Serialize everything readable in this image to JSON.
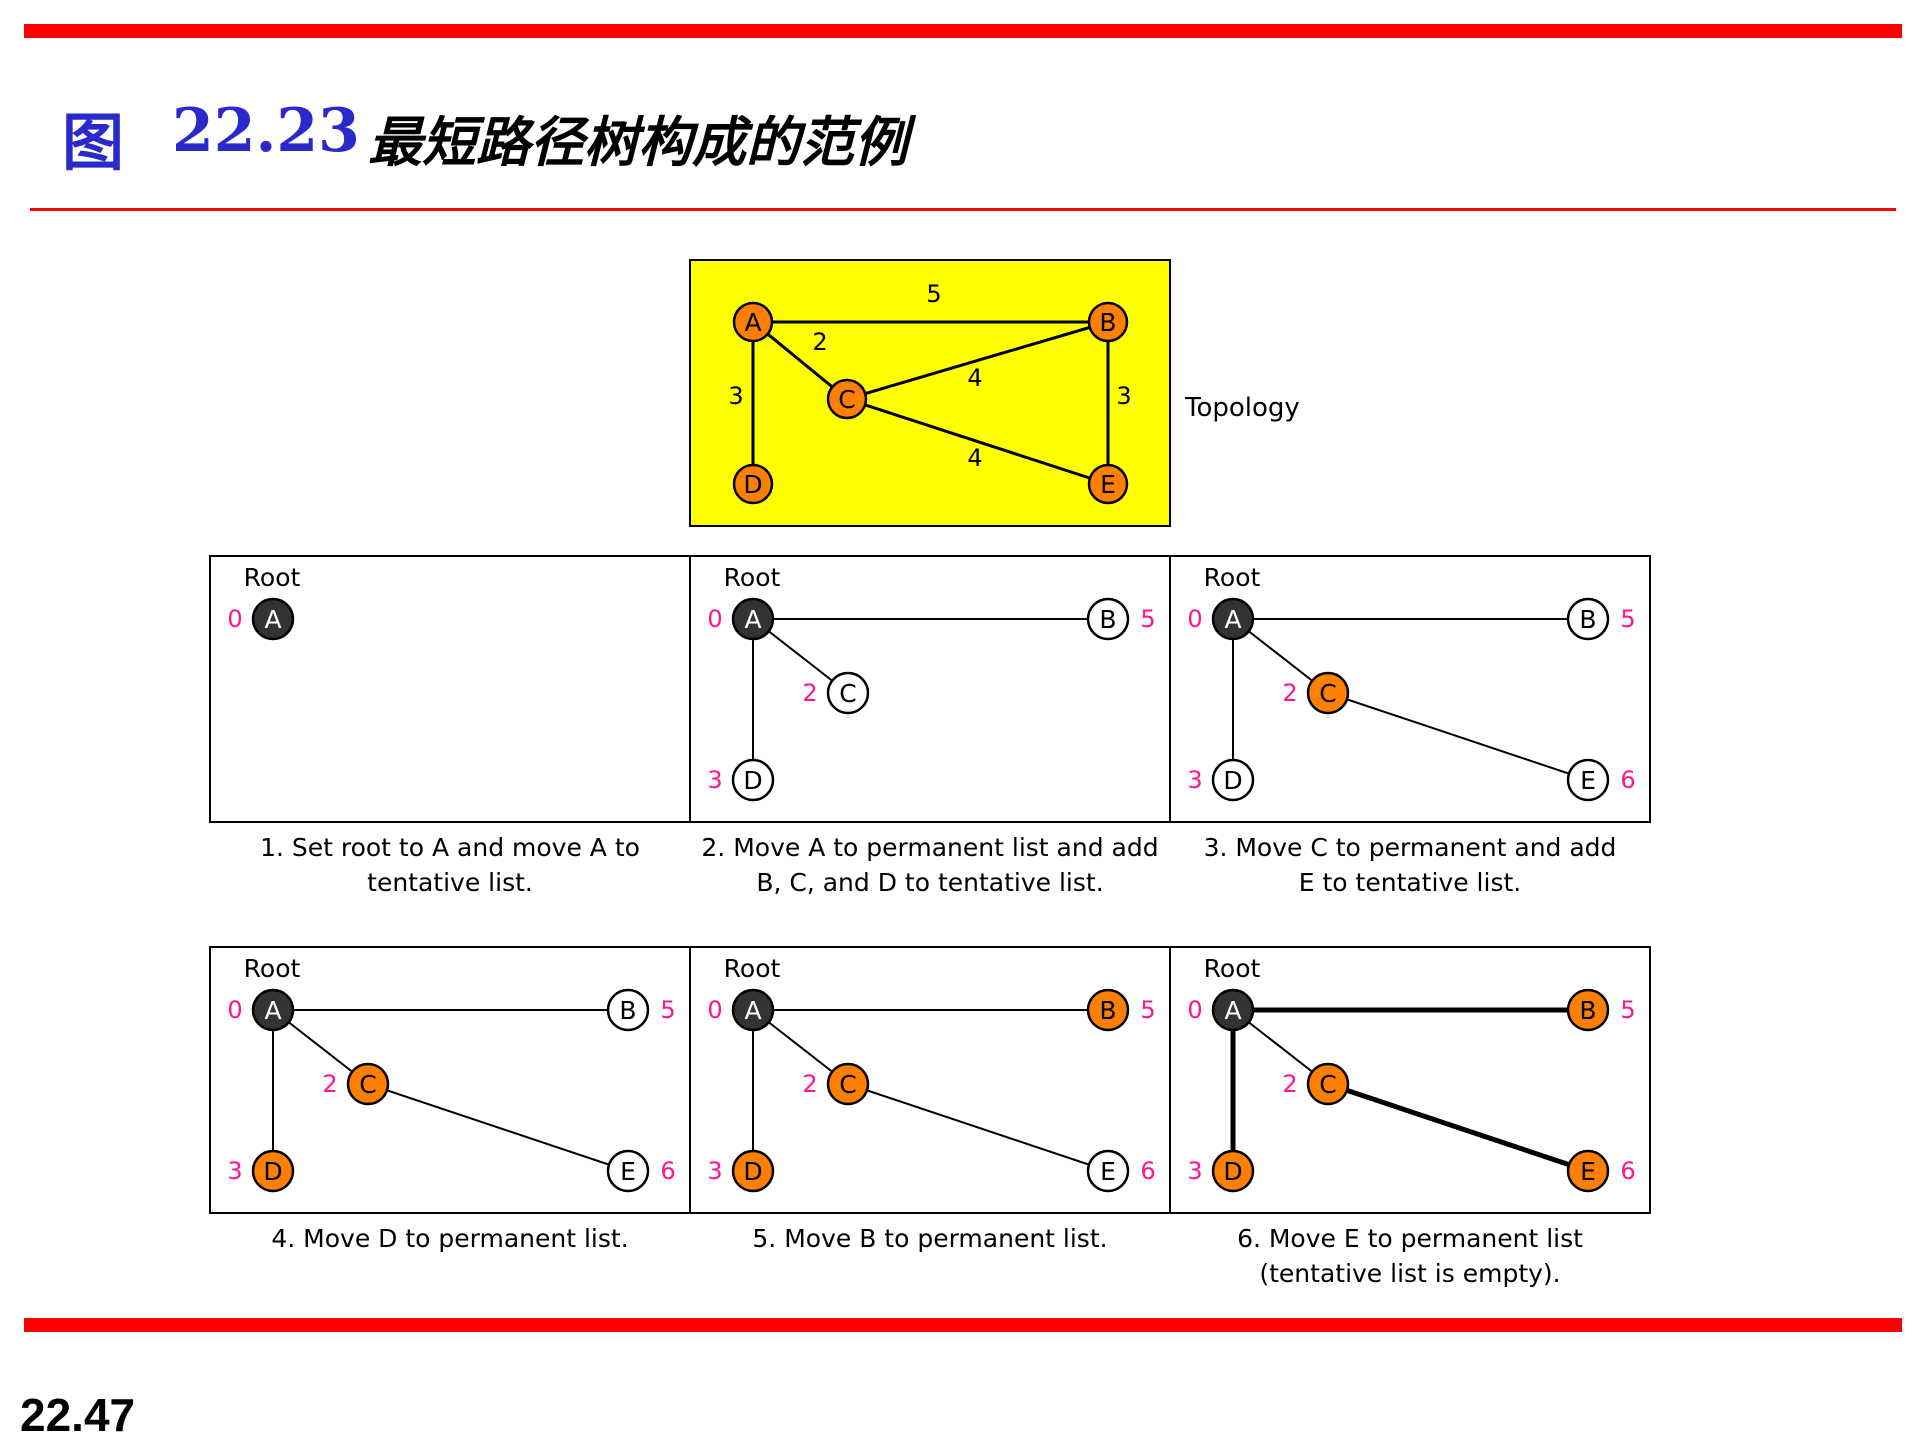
{
  "header": {
    "figure_label": "图",
    "figure_number": "22.23",
    "title": "最短路径树构成的范例"
  },
  "footer": {
    "page_number": "22.47"
  },
  "topology": {
    "label": "Topology",
    "background": "#ffff00",
    "nodes": [
      "A",
      "B",
      "C",
      "D",
      "E"
    ],
    "edges": [
      {
        "from": "A",
        "to": "B",
        "cost": "5"
      },
      {
        "from": "A",
        "to": "C",
        "cost": "2"
      },
      {
        "from": "A",
        "to": "D",
        "cost": "3"
      },
      {
        "from": "C",
        "to": "B",
        "cost": "4"
      },
      {
        "from": "C",
        "to": "E",
        "cost": "4"
      },
      {
        "from": "B",
        "to": "E",
        "cost": "3"
      }
    ]
  },
  "steps": [
    {
      "root_label": "Root",
      "caption": [
        "1. Set root to A and move A to",
        "tentative list."
      ],
      "nodes": [
        {
          "id": "A",
          "state": "root",
          "cost": "0"
        }
      ],
      "edges": []
    },
    {
      "root_label": "Root",
      "caption": [
        "2. Move A to permanent list and add",
        "B, C, and D to tentative list."
      ],
      "nodes": [
        {
          "id": "A",
          "state": "root",
          "cost": "0"
        },
        {
          "id": "B",
          "state": "tentative",
          "cost": "5"
        },
        {
          "id": "C",
          "state": "tentative",
          "cost": "2"
        },
        {
          "id": "D",
          "state": "tentative",
          "cost": "3"
        }
      ],
      "edges": [
        {
          "from": "A",
          "to": "B"
        },
        {
          "from": "A",
          "to": "C"
        },
        {
          "from": "A",
          "to": "D"
        }
      ]
    },
    {
      "root_label": "Root",
      "caption": [
        "3. Move C to permanent and add",
        "E to tentative list."
      ],
      "nodes": [
        {
          "id": "A",
          "state": "root",
          "cost": "0"
        },
        {
          "id": "B",
          "state": "tentative",
          "cost": "5"
        },
        {
          "id": "C",
          "state": "permanent",
          "cost": "2"
        },
        {
          "id": "D",
          "state": "tentative",
          "cost": "3"
        },
        {
          "id": "E",
          "state": "tentative",
          "cost": "6"
        }
      ],
      "edges": [
        {
          "from": "A",
          "to": "B"
        },
        {
          "from": "A",
          "to": "C"
        },
        {
          "from": "A",
          "to": "D"
        },
        {
          "from": "C",
          "to": "E"
        }
      ]
    },
    {
      "root_label": "Root",
      "caption": [
        "4. Move D to permanent list."
      ],
      "nodes": [
        {
          "id": "A",
          "state": "root",
          "cost": "0"
        },
        {
          "id": "B",
          "state": "tentative",
          "cost": "5"
        },
        {
          "id": "C",
          "state": "permanent",
          "cost": "2"
        },
        {
          "id": "D",
          "state": "permanent",
          "cost": "3"
        },
        {
          "id": "E",
          "state": "tentative",
          "cost": "6"
        }
      ],
      "edges": [
        {
          "from": "A",
          "to": "B"
        },
        {
          "from": "A",
          "to": "C"
        },
        {
          "from": "A",
          "to": "D"
        },
        {
          "from": "C",
          "to": "E"
        }
      ]
    },
    {
      "root_label": "Root",
      "caption": [
        "5. Move B to permanent list."
      ],
      "nodes": [
        {
          "id": "A",
          "state": "root",
          "cost": "0"
        },
        {
          "id": "B",
          "state": "permanent",
          "cost": "5"
        },
        {
          "id": "C",
          "state": "permanent",
          "cost": "2"
        },
        {
          "id": "D",
          "state": "permanent",
          "cost": "3"
        },
        {
          "id": "E",
          "state": "tentative",
          "cost": "6"
        }
      ],
      "edges": [
        {
          "from": "A",
          "to": "B"
        },
        {
          "from": "A",
          "to": "C"
        },
        {
          "from": "A",
          "to": "D"
        },
        {
          "from": "C",
          "to": "E"
        }
      ]
    },
    {
      "root_label": "Root",
      "caption": [
        "6. Move E to permanent list",
        "(tentative list is empty)."
      ],
      "nodes": [
        {
          "id": "A",
          "state": "root",
          "cost": "0"
        },
        {
          "id": "B",
          "state": "permanent",
          "cost": "5"
        },
        {
          "id": "C",
          "state": "permanent",
          "cost": "2"
        },
        {
          "id": "D",
          "state": "permanent",
          "cost": "3"
        },
        {
          "id": "E",
          "state": "permanent",
          "cost": "6"
        }
      ],
      "edges": [
        {
          "from": "A",
          "to": "B",
          "bold": true
        },
        {
          "from": "A",
          "to": "C"
        },
        {
          "from": "A",
          "to": "D",
          "bold": true
        },
        {
          "from": "C",
          "to": "E",
          "bold": true
        }
      ]
    }
  ],
  "colors": {
    "bar": "#ff0000",
    "node_fill": "#ff8000",
    "root_fill": "#333333",
    "cost_text": "#ff1493",
    "title_blue": "#2a2acb"
  }
}
